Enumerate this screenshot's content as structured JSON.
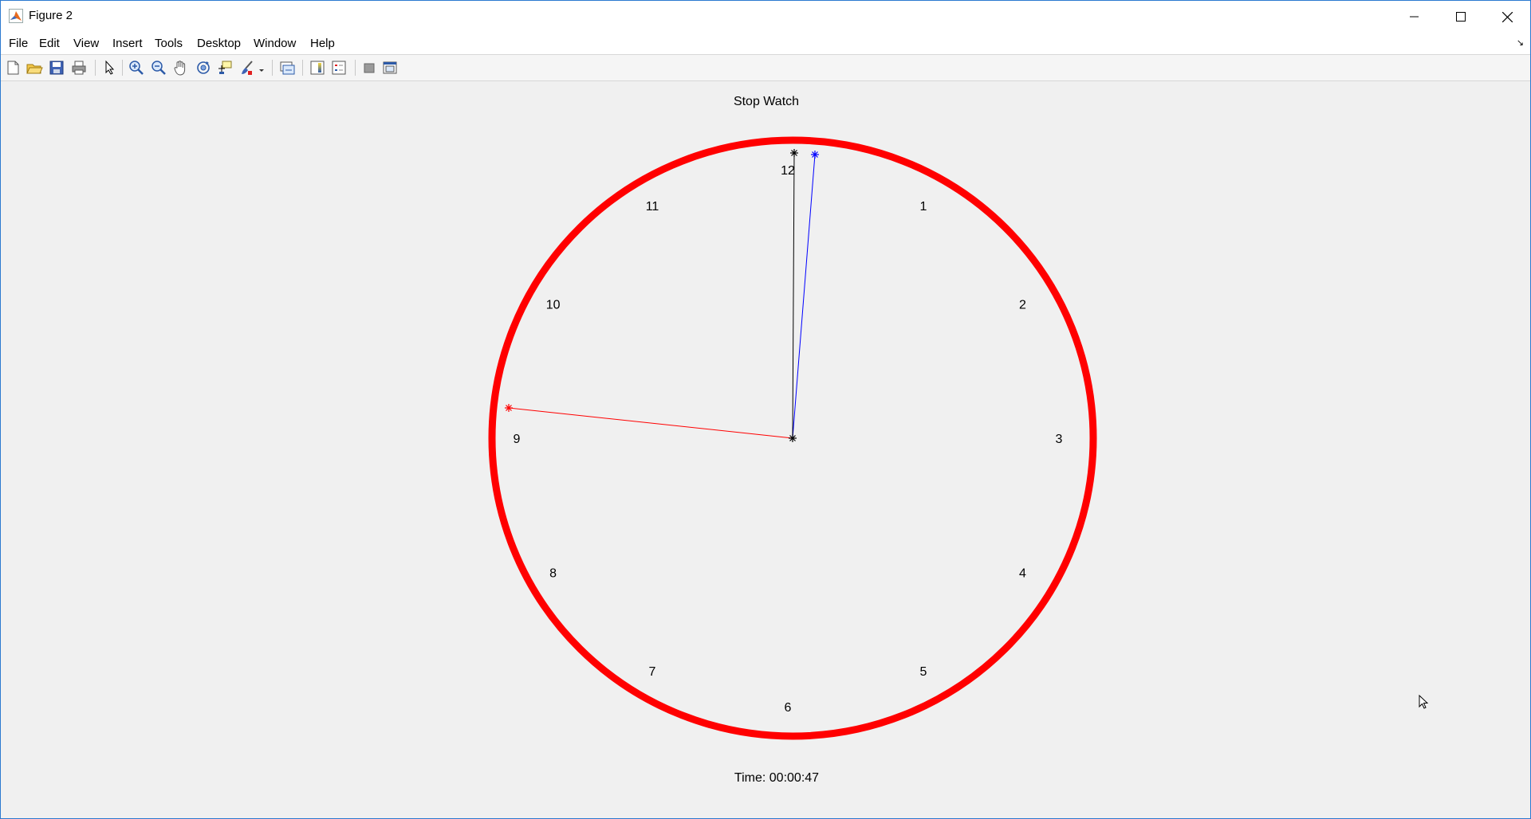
{
  "window": {
    "title": "Figure 2",
    "controls": [
      "minimize",
      "maximize",
      "close"
    ]
  },
  "menu": {
    "items": [
      "File",
      "Edit",
      "View",
      "Insert",
      "Tools",
      "Desktop",
      "Window",
      "Help"
    ]
  },
  "toolbar": {
    "icons": [
      "new-figure-icon",
      "open-file-icon",
      "save-icon",
      "print-icon",
      "edit-plot-arrow-icon",
      "zoom-in-icon",
      "zoom-out-icon",
      "pan-hand-icon",
      "rotate-3d-icon",
      "data-cursor-icon",
      "brush-icon",
      "brush-dropdown-icon",
      "link-plot-icon",
      "insert-colorbar-icon",
      "insert-legend-icon",
      "hide-plot-tools-icon",
      "show-plot-tools-icon"
    ]
  },
  "figure": {
    "title": "Stop Watch",
    "time_label": "Time: 00:00:47",
    "clock_numbers": [
      "12",
      "1",
      "2",
      "3",
      "4",
      "5",
      "6",
      "7",
      "8",
      "9",
      "10",
      "11"
    ],
    "colors": {
      "rim": "#ff0000",
      "seconds_hand": "#ff0000",
      "minutes_hand": "#0000ff",
      "hours_hand": "#000000"
    }
  }
}
